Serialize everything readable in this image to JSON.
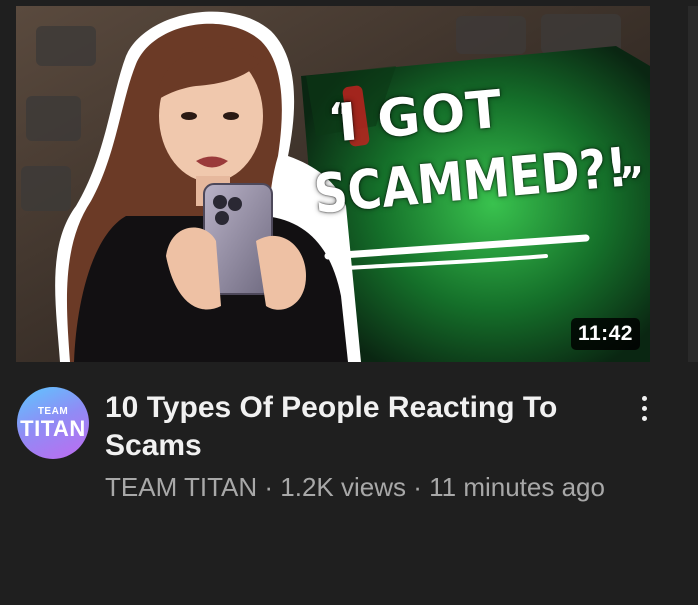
{
  "thumbnail": {
    "overlay_quote_open": "“",
    "overlay_line1": "I GOT",
    "overlay_line2": "SCAMMED?!",
    "overlay_quote_close": "”",
    "duration": "11:42",
    "accent_green": "#1fa83a",
    "accent_red": "#d02020"
  },
  "channel": {
    "avatar_top": "TEAM",
    "avatar_bottom": "TITAN",
    "name": "TEAM TITAN"
  },
  "video": {
    "title": "10 Types Of People Reacting To Scams",
    "views": "1.2K views",
    "age": "11 minutes ago",
    "separator": " · "
  },
  "icons": {
    "more": "more-vert-icon"
  }
}
